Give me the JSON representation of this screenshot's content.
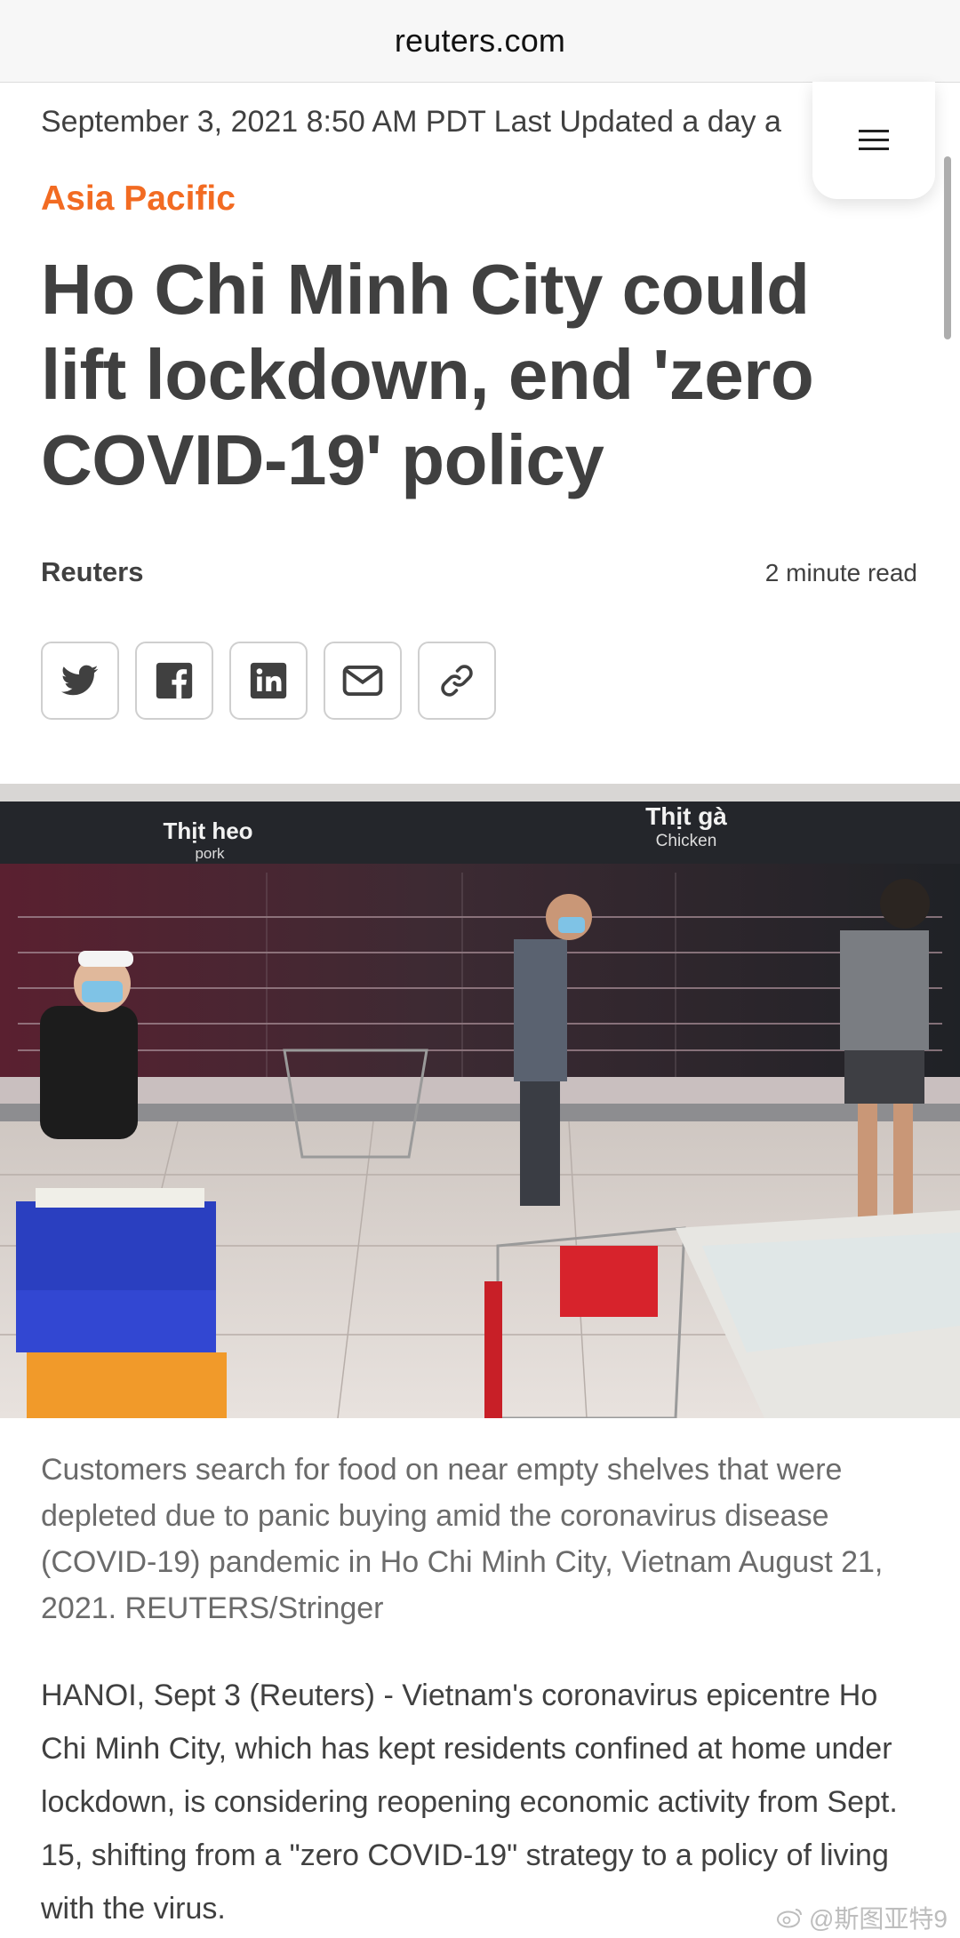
{
  "browser": {
    "url": "reuters.com"
  },
  "article": {
    "dateline": "September 3, 2021 8:50 AM PDT Last Updated a day a",
    "section": "Asia Pacific",
    "headline": "Ho Chi Minh City could lift lockdown, end 'zero COVID-19' policy",
    "byline": "Reuters",
    "read_time": "2 minute read",
    "share_icons": [
      "twitter-icon",
      "facebook-icon",
      "linkedin-icon",
      "email-icon",
      "link-icon"
    ],
    "photo": {
      "signs": {
        "left_main": "Thịt heo",
        "left_sub": "pork",
        "right_main": "Thịt gà",
        "right_sub": "Chicken"
      }
    },
    "caption": "Customers search for food on near empty shelves that were depleted due to panic buying amid the coronavirus disease (COVID-19) pandemic in Ho Chi Minh City, Vietnam August 21, 2021. REUTERS/Stringer",
    "body": "HANOI, Sept 3 (Reuters) - Vietnam's coronavirus epicentre Ho Chi Minh City, which has kept residents confined at home under lockdown, is considering reopening economic activity from Sept. 15, shifting from a \"zero COVID-19\" strategy to a policy of living with the virus."
  },
  "watermark": {
    "text": "@斯图亚特9"
  },
  "colors": {
    "accent": "#f26b22",
    "text": "#404040",
    "caption": "#6b6b6b"
  }
}
